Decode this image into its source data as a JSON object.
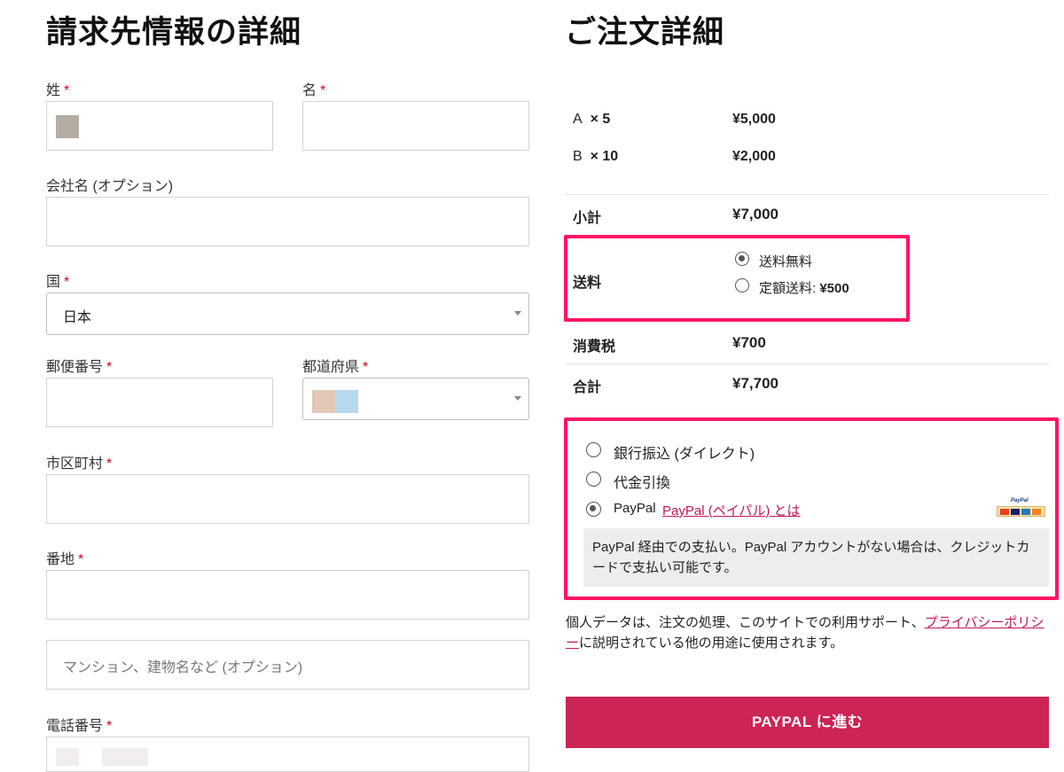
{
  "billing": {
    "title": "請求先情報の詳細",
    "required_mark": "*",
    "last_name_label": "姓",
    "first_name_label": "名",
    "company_label": "会社名 (オプション)",
    "country_label": "国",
    "country_value": "日本",
    "postcode_label": "郵便番号",
    "prefecture_label": "都道府県",
    "city_label": "市区町村",
    "address_label": "番地",
    "address2_placeholder": "マンション、建物名など (オプション)",
    "phone_label": "電話番号"
  },
  "order": {
    "title": "ご注文詳細",
    "items": [
      {
        "name": "A",
        "qty": "× 5",
        "price": "¥5,000"
      },
      {
        "name": "B",
        "qty": "× 10",
        "price": "¥2,000"
      }
    ],
    "subtotal_label": "小計",
    "subtotal_value": "¥7,000",
    "shipping_label": "送料",
    "shipping_options": [
      {
        "label": "送料無料",
        "amount": "",
        "selected": true
      },
      {
        "label": "定額送料: ",
        "amount": "¥500",
        "selected": false
      }
    ],
    "tax_label": "消費税",
    "tax_value": "¥700",
    "total_label": "合計",
    "total_value": "¥7,700"
  },
  "payment": {
    "methods": [
      {
        "label": "銀行振込 (ダイレクト)",
        "selected": false
      },
      {
        "label": "代金引換",
        "selected": false
      },
      {
        "label": "PayPal",
        "selected": true
      }
    ],
    "paypal_link": "PayPal (ペイパル) とは",
    "paypal_logo_text": "PayPal",
    "paypal_description": "PayPal 経由での支払い。PayPal アカウントがない場合は、クレジットカードで支払い可能です。"
  },
  "privacy": {
    "text_before": "個人データは、注文の処理、このサイトでの利用サポート、",
    "link_text": "プライバシーポリシー",
    "text_after": "に説明されている他の用途に使用されます。"
  },
  "submit_label": "PAYPAL に進む",
  "colors": {
    "accent": "#cc2454",
    "highlight": "#ff1464",
    "link": "#c2185b"
  }
}
